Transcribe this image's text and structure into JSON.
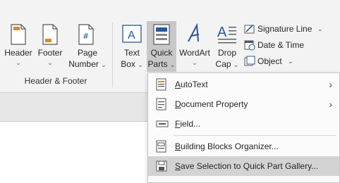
{
  "ribbon": {
    "header_footer_group": {
      "label": "Header & Footer",
      "buttons": [
        {
          "label": "Header",
          "icon": "header-page-icon"
        },
        {
          "label": "Footer",
          "icon": "footer-page-icon"
        },
        {
          "label_line1": "Page",
          "label_line2": "Number",
          "icon": "page-number-icon"
        }
      ]
    },
    "text_group": {
      "text_box": {
        "line1": "Text",
        "line2": "Box"
      },
      "quick_parts": {
        "line1": "Quick",
        "line2": "Parts"
      },
      "wordart": {
        "label": "WordArt"
      },
      "drop_cap": {
        "line1": "Drop",
        "line2": "Cap"
      },
      "signature_line": "Signature Line",
      "date_time": "Date & Time",
      "object": "Object"
    },
    "chevron": "⌄"
  },
  "menu": {
    "items": [
      {
        "pre": "",
        "u": "A",
        "post": "utoText",
        "icon": "autotext-icon",
        "submenu": true
      },
      {
        "pre": "",
        "u": "D",
        "post": "ocument Property",
        "icon": "document-property-icon",
        "submenu": true
      },
      {
        "pre": "",
        "u": "F",
        "post": "ield...",
        "icon": "field-icon",
        "submenu": false
      },
      {
        "pre": "",
        "u": "B",
        "post": "uilding Blocks Organizer...",
        "icon": "building-blocks-icon",
        "submenu": false
      },
      {
        "pre": "",
        "u": "S",
        "post": "ave Selection to Quick Part Gallery...",
        "icon": "save-selection-icon",
        "submenu": false
      }
    ],
    "arrow": "›"
  },
  "colors": {
    "accent": "#2b579a",
    "highlight": "#d3d3d3",
    "quick_parts_active": "#c8c8c8"
  }
}
